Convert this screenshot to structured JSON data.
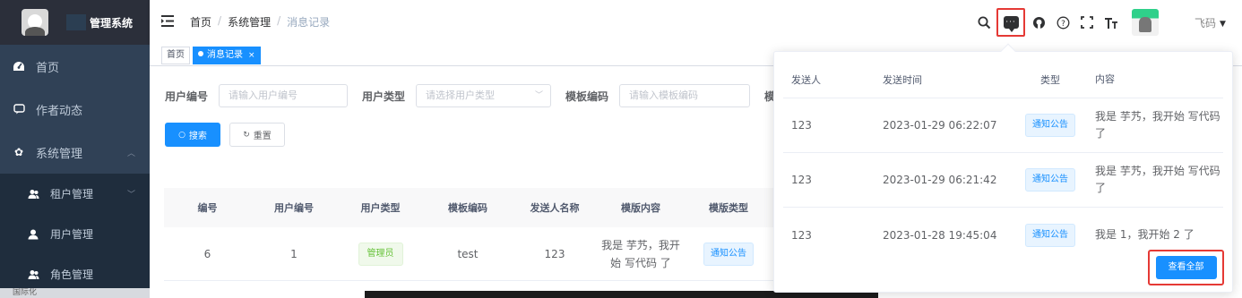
{
  "sidebar": {
    "title": "管理系统",
    "items": [
      {
        "label": "首页",
        "icon": "dashboard-icon"
      },
      {
        "label": "作者动态",
        "icon": "chat-icon"
      },
      {
        "label": "系统管理",
        "icon": "gear-icon"
      }
    ],
    "subitems": [
      {
        "label": "租户管理",
        "icon": "peoples-icon"
      },
      {
        "label": "用户管理",
        "icon": "user-icon"
      },
      {
        "label": "角色管理",
        "icon": "peoples-icon"
      }
    ],
    "footer": "国际化"
  },
  "navbar": {
    "breadcrumb": [
      "首页",
      "系统管理",
      "消息记录"
    ],
    "user_name": "飞码",
    "icons": [
      "search-icon",
      "message-icon",
      "github-icon",
      "help-icon",
      "fullscreen-icon",
      "font-size-icon"
    ]
  },
  "tags": [
    {
      "label": "首页",
      "active": false
    },
    {
      "label": "消息记录",
      "active": true
    }
  ],
  "filters": {
    "user_id_label": "用户编号",
    "user_id_placeholder": "请输入用户编号",
    "user_type_label": "用户类型",
    "user_type_placeholder": "请选择用户类型",
    "template_code_label": "模板编码",
    "template_code_placeholder": "请输入模板编码",
    "extra_label": "模",
    "search_button": "搜索",
    "reset_button": "重置"
  },
  "table": {
    "columns": [
      "编号",
      "用户编号",
      "用户类型",
      "模板编码",
      "发送人名称",
      "模版内容",
      "模版类型"
    ],
    "rows": [
      {
        "id": "6",
        "user_id": "1",
        "user_type": "管理员",
        "template_code": "test",
        "sender": "123",
        "content": "我是 芋艿，我开始 写代码 了",
        "template_type": "通知公告"
      }
    ]
  },
  "popover": {
    "columns": [
      "发送人",
      "发送时间",
      "类型",
      "内容"
    ],
    "rows": [
      {
        "sender": "123",
        "time": "2023-01-29 06:22:07",
        "type": "通知公告",
        "content": "我是 芋艿，我开始 写代码 了"
      },
      {
        "sender": "123",
        "time": "2023-01-29 06:21:42",
        "type": "通知公告",
        "content": "我是 芋艿，我开始 写代码 了"
      },
      {
        "sender": "123",
        "time": "2023-01-28 19:45:04",
        "type": "通知公告",
        "content": "我是 1，我开始 2 了"
      }
    ],
    "view_all_button": "查看全部"
  },
  "colors": {
    "sidebar_bg": "#304156",
    "primary": "#1890ff",
    "highlight_border": "#e53935"
  }
}
